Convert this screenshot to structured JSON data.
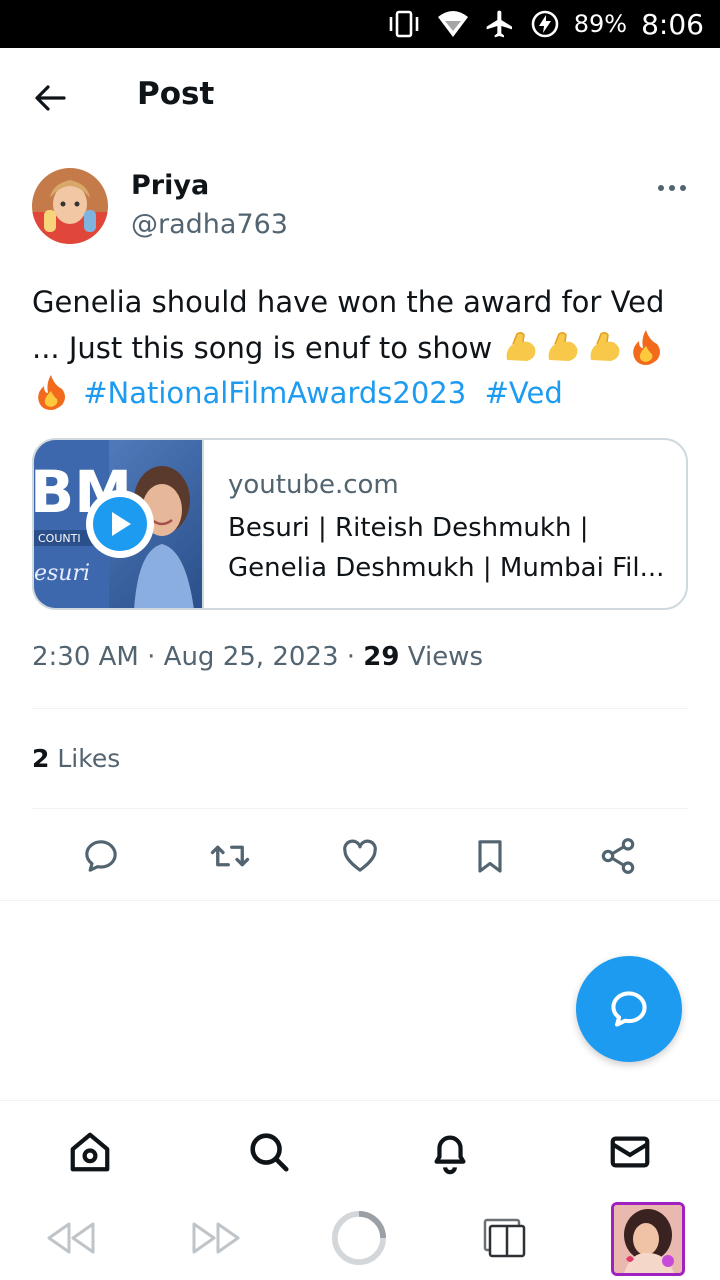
{
  "status_bar": {
    "battery": "89%",
    "time": "8:06"
  },
  "header": {
    "title": "Post"
  },
  "post": {
    "author_name": "Priya",
    "author_handle": "@radha763",
    "text_part1": "Genelia should have won the award for Ved ... Just this song is enuf to show",
    "hashtag1": "#NationalFilmAwards2023",
    "hashtag2": "#Ved",
    "card": {
      "domain": "youtube.com",
      "title": "Besuri | Riteish Deshmukh | Genelia Deshmukh | Mumbai Fil..."
    },
    "time": "2:30 AM",
    "date": "Aug 25, 2023",
    "views_count": "29",
    "views_label": "Views",
    "likes_count": "2",
    "likes_label": "Likes"
  },
  "icons": {
    "reply": "reply-icon",
    "retweet": "retweet-icon",
    "like": "heart-icon",
    "bookmark": "bookmark-icon",
    "share": "share-icon",
    "home": "home-icon",
    "search": "search-icon",
    "notifications": "bell-icon",
    "messages": "mail-icon"
  },
  "colors": {
    "accent": "#1d9bf0",
    "text": "#0f1419",
    "muted": "#536471",
    "border": "#cfd9de"
  }
}
